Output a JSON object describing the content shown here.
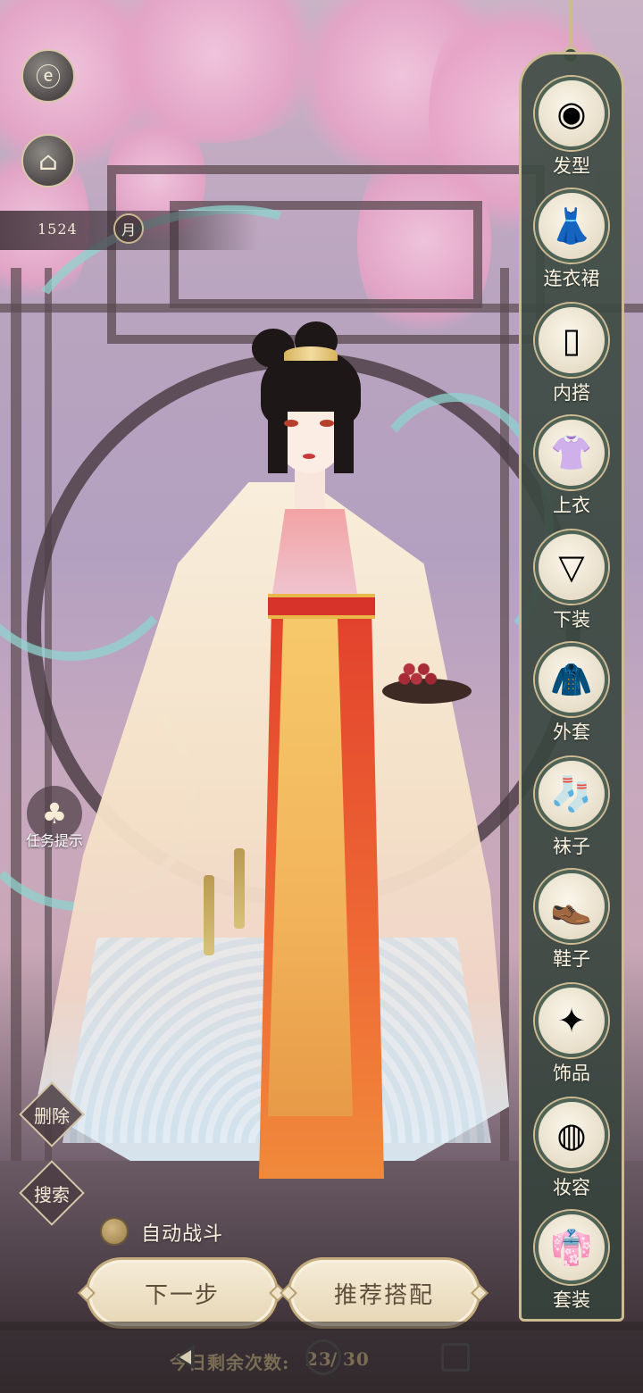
{
  "top_buttons": {
    "back_icon": "back-arrow-icon",
    "back_glyph": "ⓔ",
    "shop_icon": "pavilion-icon",
    "shop_glyph": "⌂"
  },
  "date": {
    "year": "1524",
    "month_label": "月"
  },
  "side_menu": {
    "items": [
      {
        "label": "发型",
        "icon": "hairstyle-icon",
        "glyph": "◉"
      },
      {
        "label": "连衣裙",
        "icon": "dress-icon",
        "glyph": "👗"
      },
      {
        "label": "内搭",
        "icon": "camisole-icon",
        "glyph": "▯"
      },
      {
        "label": "上衣",
        "icon": "top-icon",
        "glyph": "👚"
      },
      {
        "label": "下装",
        "icon": "skirt-icon",
        "glyph": "▽"
      },
      {
        "label": "外套",
        "icon": "coat-icon",
        "glyph": "🧥"
      },
      {
        "label": "袜子",
        "icon": "socks-icon",
        "glyph": "🧦"
      },
      {
        "label": "鞋子",
        "icon": "shoes-icon",
        "glyph": "👞"
      },
      {
        "label": "饰品",
        "icon": "hairpin-icon",
        "glyph": "✦"
      },
      {
        "label": "妆容",
        "icon": "makeup-icon",
        "glyph": "◍"
      },
      {
        "label": "套装",
        "icon": "outfit-set-icon",
        "glyph": "👘"
      }
    ]
  },
  "left_actions": {
    "task_hint_label": "任务提示",
    "task_hint_icon": "clover-icon",
    "task_hint_glyph": "♣",
    "delete_label": "删除",
    "search_label": "搜索"
  },
  "auto_battle": {
    "label": "自动战斗",
    "enabled": false
  },
  "buttons": {
    "next_label": "下一步",
    "recommend_label": "推荐搭配"
  },
  "remaining": {
    "label": "今日剩余次数:",
    "current": "23",
    "separator": "/",
    "total": "30"
  },
  "nav": {
    "back_icon": "nav-back-icon",
    "home_icon": "nav-home-icon",
    "recent_icon": "nav-recent-icon"
  }
}
